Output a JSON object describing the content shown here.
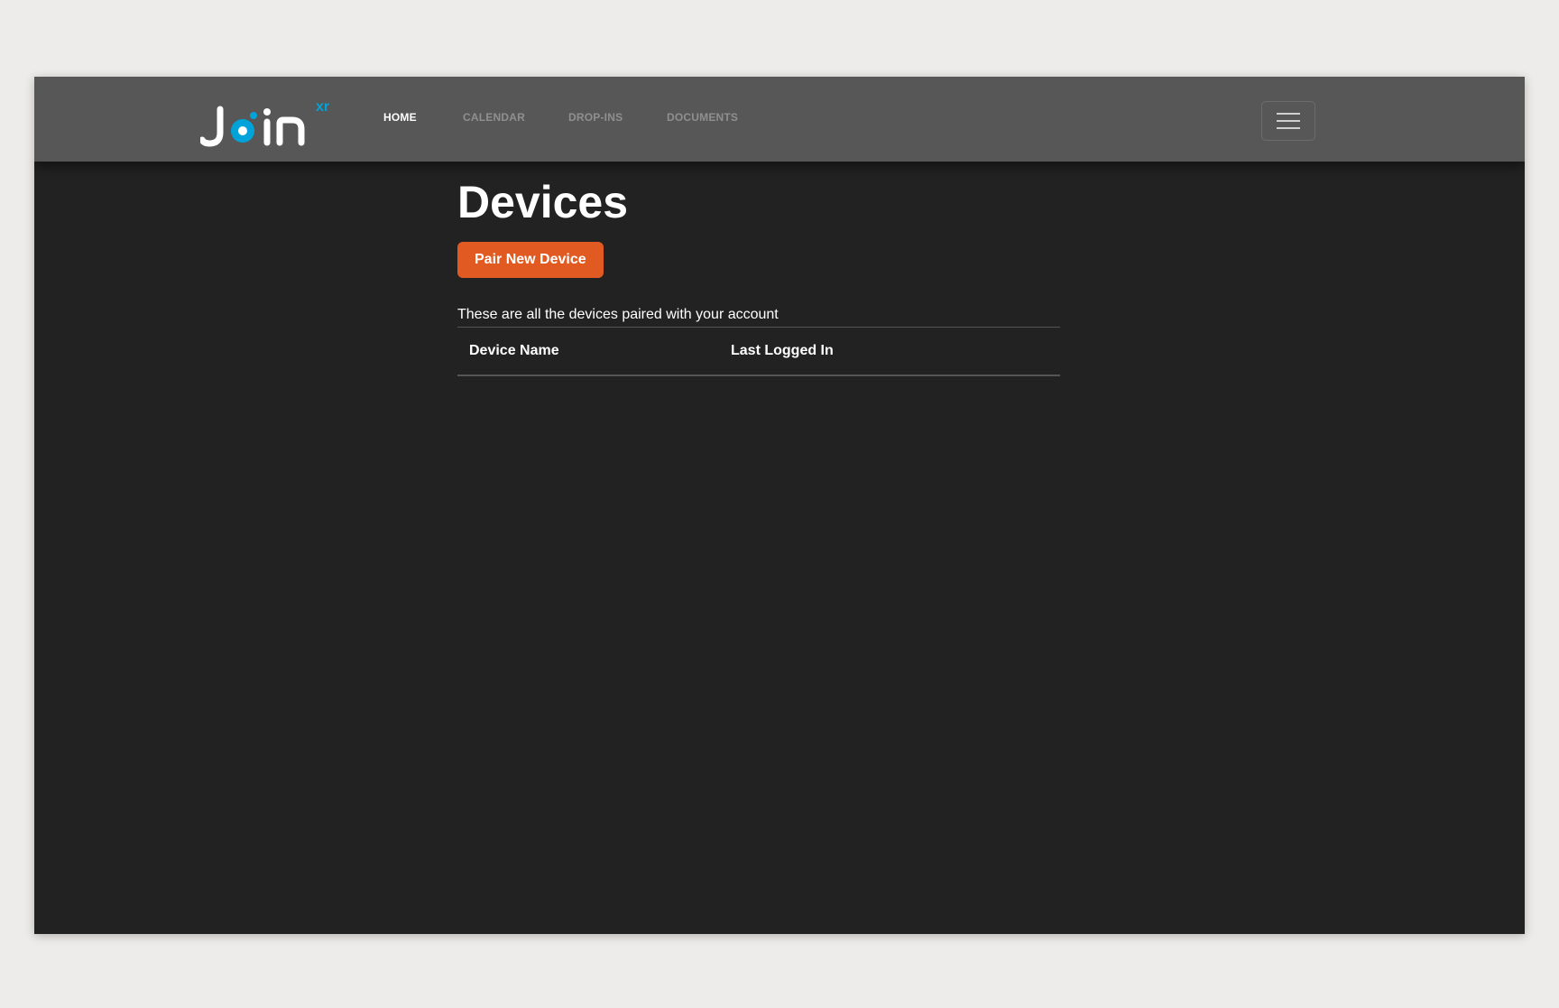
{
  "brand": {
    "logo_text": "Join",
    "logo_superscript": "xr",
    "accent_color": "#00a3d9"
  },
  "nav": {
    "items": [
      {
        "label": "HOME",
        "active": true
      },
      {
        "label": "CALENDAR",
        "active": false
      },
      {
        "label": "DROP-INS",
        "active": false
      },
      {
        "label": "DOCUMENTS",
        "active": false
      }
    ],
    "menu_icon": "hamburger-menu-icon"
  },
  "main": {
    "title": "Devices",
    "pair_button_label": "Pair New Device",
    "pair_button_color": "#e05a21",
    "description": "These are all the devices paired with your account",
    "table": {
      "headers": [
        "Device Name",
        "Last Logged In"
      ],
      "rows": []
    }
  }
}
